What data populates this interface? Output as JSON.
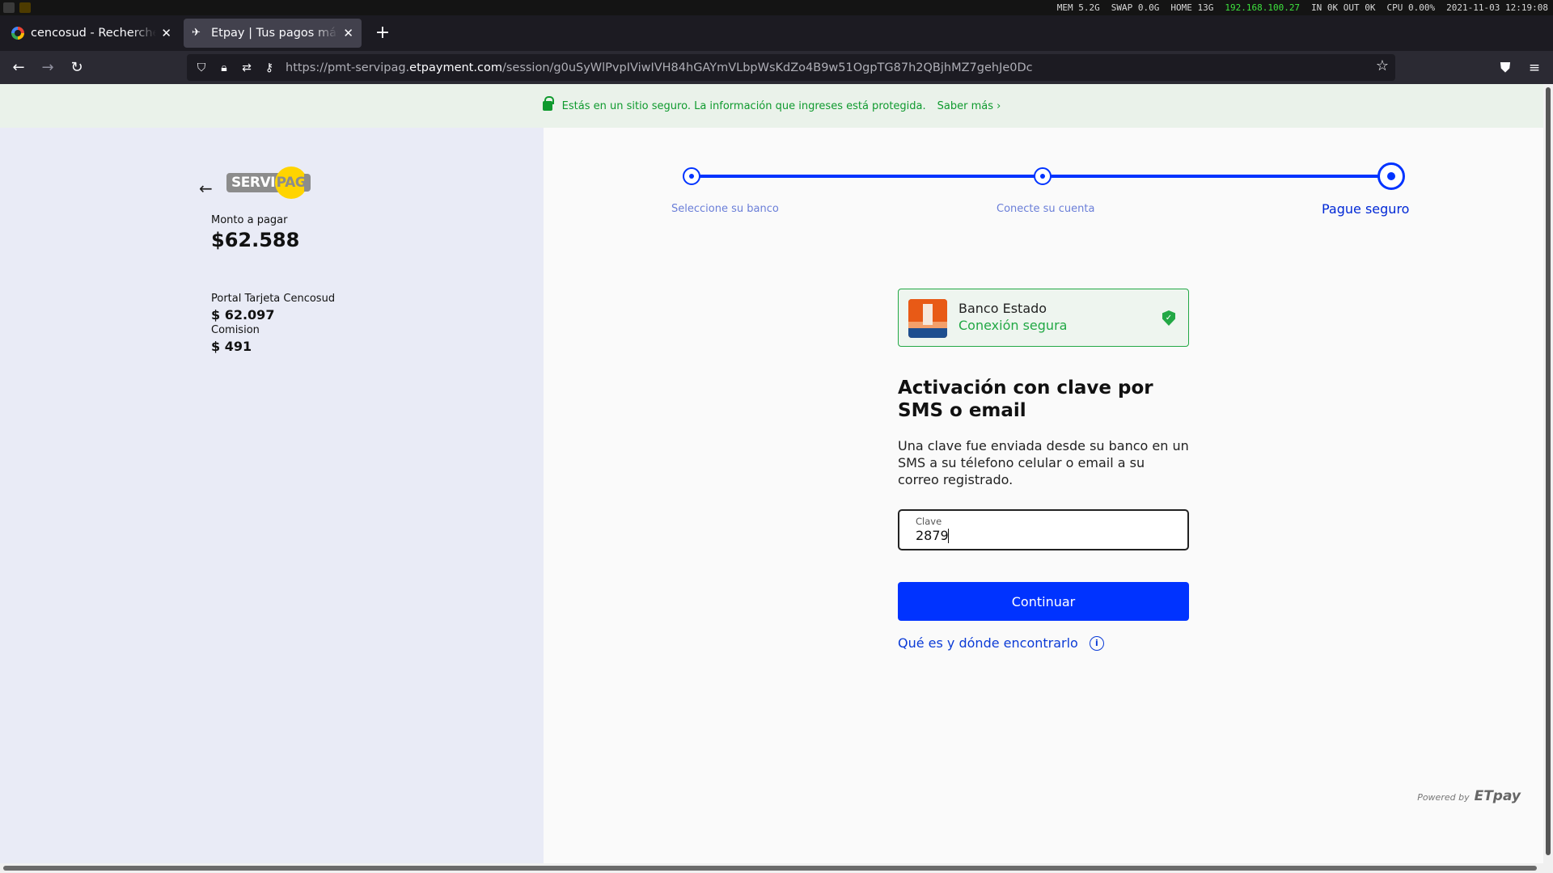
{
  "system_bar": {
    "mem": "MEM 5.2G",
    "swap": "SWAP 0.0G",
    "home": "HOME 13G",
    "ip": "192.168.100.27",
    "net": "IN 0K OUT 0K",
    "cpu": "CPU 0.00%",
    "datetime": "2021-11-03 12:19:08"
  },
  "browser": {
    "tabs": [
      {
        "title": "cencosud - Recherche Google",
        "icon": "google-icon"
      },
      {
        "title": "Etpay | Tus pagos más seguros",
        "icon": "etpay-icon"
      }
    ],
    "url_host_prefix": "https://pmt-servipag.",
    "url_host_domain": "etpayment.com",
    "url_path": "/session/g0uSyWlPvpIViwIVH84hGAYmVLbpWsKdZo4B9w51OgpTG87h2QBjhMZ7gehJe0Dc"
  },
  "secure_banner": {
    "text": "Estás en un sitio seguro. La información que ingreses está protegida.",
    "link": "Saber más ›"
  },
  "summary": {
    "logo_left": "SERVI",
    "logo_right": "PAG",
    "amount_label": "Monto a pagar",
    "amount_value": "$62.588",
    "item_label": "Portal Tarjeta Cencosud",
    "item_value": "$ 62.097",
    "fee_label": "Comision",
    "fee_value": "$ 491"
  },
  "stepper": {
    "steps": [
      "Seleccione su banco",
      "Conecte su cuenta",
      "Pague seguro"
    ],
    "active_index": 2
  },
  "bank": {
    "name": "Banco Estado",
    "status": "Conexión segura",
    "colors": {
      "accent": "#22a845",
      "logo": "#e35a1a"
    }
  },
  "form": {
    "heading": "Activación con clave por SMS o email",
    "description": "Una clave fue enviada desde su banco en un SMS a su télefono celular o email a su correo registrado.",
    "field_label": "Clave",
    "field_value": "2879",
    "submit_label": "Continuar",
    "help_link": "Qué es y dónde encontrarlo"
  },
  "footer": {
    "powered_by": "Powered by",
    "brand": "ETpay"
  },
  "colors": {
    "primary": "#0033ff",
    "secure_green": "#0f9a2e"
  }
}
